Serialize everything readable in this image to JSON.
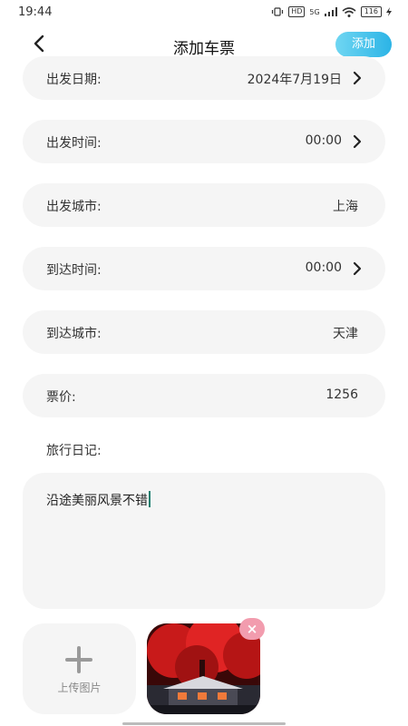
{
  "status_bar": {
    "time": "19:44",
    "network": "5G",
    "hd": "HD",
    "battery": "116"
  },
  "nav": {
    "title": "添加车票",
    "add_label": "添加"
  },
  "form": {
    "departure_date": {
      "label": "出发日期:",
      "value": "2024年7月19日"
    },
    "departure_time": {
      "label": "出发时间:",
      "value": "00:00"
    },
    "departure_city": {
      "label": "出发城市:",
      "value": "上海"
    },
    "arrival_time": {
      "label": "到达时间:",
      "value": "00:00"
    },
    "arrival_city": {
      "label": "到达城市:",
      "value": "天津"
    },
    "price": {
      "label": "票价:",
      "value": "1256"
    }
  },
  "diary": {
    "label": "旅行日记:",
    "text": "沿途美丽风景不错"
  },
  "upload": {
    "label": "上传图片"
  },
  "colors": {
    "accent_start": "#6fd6f2",
    "accent_end": "#2cb4e6",
    "row_bg": "#f5f5f5",
    "remove_badge": "#f29cae"
  },
  "icons": {
    "back": "chevron-left-icon",
    "row_arrow": "chevron-right-icon",
    "upload": "plus-icon",
    "remove": "close-icon"
  }
}
